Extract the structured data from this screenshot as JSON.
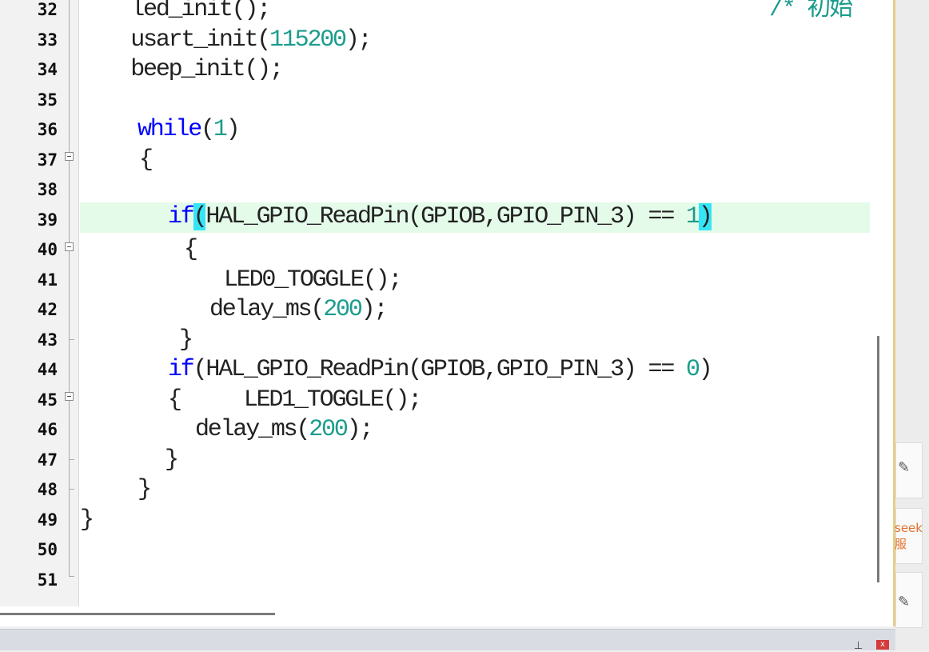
{
  "gutter": {
    "line_numbers": [
      "32",
      "33",
      "34",
      "35",
      "36",
      "37",
      "38",
      "39",
      "40",
      "41",
      "42",
      "43",
      "44",
      "45",
      "46",
      "47",
      "48",
      "49",
      "50",
      "51"
    ]
  },
  "code": {
    "lines": {
      "l32_a": "    led_init();",
      "l32_comment": "/* 初始",
      "l33_a": "    usart_init(",
      "l33_num": "115200",
      "l33_b": ");",
      "l34": "    beep_init();",
      "l36_kw": "while",
      "l36_a": "(",
      "l36_num": "1",
      "l36_b": ")",
      "l37": "{",
      "l39_kw": "if",
      "l39_open": "(",
      "l39_a": "HAL_GPIO_ReadPin(GPIOB,GPIO_PIN_3) == ",
      "l39_num": "1",
      "l39_close": ")",
      "l40": "{",
      "l41": "LED0_TOGGLE();",
      "l42_a": "delay_ms(",
      "l42_num": "200",
      "l42_b": ");",
      "l43": "}",
      "l44_kw": "if",
      "l44_a": "(HAL_GPIO_ReadPin(GPIOB,GPIO_PIN_3) == ",
      "l44_num": "0",
      "l44_b": ")",
      "l45": "{     LED1_TOGGLE();",
      "l46_a": "delay_ms(",
      "l46_num": "200",
      "l46_b": ");",
      "l47": "}",
      "l48": "}",
      "l49": "}"
    }
  },
  "side": {
    "text_line1": "seek",
    "text_line2": "服"
  },
  "bottom": {
    "pin_icon": "pin-icon",
    "close_label": "x"
  }
}
